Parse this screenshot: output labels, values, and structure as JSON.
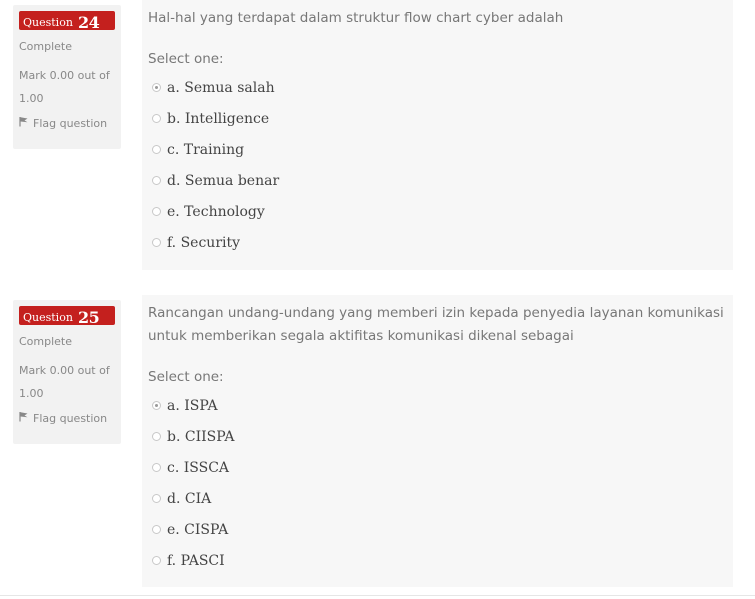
{
  "questions": [
    {
      "number_label": "Question",
      "number": "24",
      "state": "Complete",
      "mark": "Mark 0.00 out of 1.00",
      "flag": "Flag question",
      "text": "Hal-hal yang terdapat dalam struktur flow chart cyber adalah",
      "prompt": "Select one:",
      "options": [
        {
          "label": "a. Semua salah",
          "checked": true
        },
        {
          "label": "b. Intelligence",
          "checked": false
        },
        {
          "label": "c. Training",
          "checked": false
        },
        {
          "label": "d. Semua benar",
          "checked": false
        },
        {
          "label": "e. Technology",
          "checked": false
        },
        {
          "label": "f. Security",
          "checked": false
        }
      ]
    },
    {
      "number_label": "Question",
      "number": "25",
      "state": "Complete",
      "mark": "Mark 0.00 out of 1.00",
      "flag": "Flag question",
      "text": "Rancangan undang-undang yang memberi izin kepada penyedia layanan komunikasi untuk memberikan segala aktifitas komunikasi dikenal sebagai",
      "prompt": "Select one:",
      "options": [
        {
          "label": "a. ISPA",
          "checked": true
        },
        {
          "label": "b. CIISPA",
          "checked": false
        },
        {
          "label": "c. ISSCA",
          "checked": false
        },
        {
          "label": "d. CIA",
          "checked": false
        },
        {
          "label": "e. CISPA",
          "checked": false
        },
        {
          "label": "f. PASCI",
          "checked": false
        }
      ]
    }
  ],
  "colors": {
    "badge": "#c4201e",
    "info_bg": "#f2f2f2",
    "content_bg": "#f7f7f7"
  }
}
